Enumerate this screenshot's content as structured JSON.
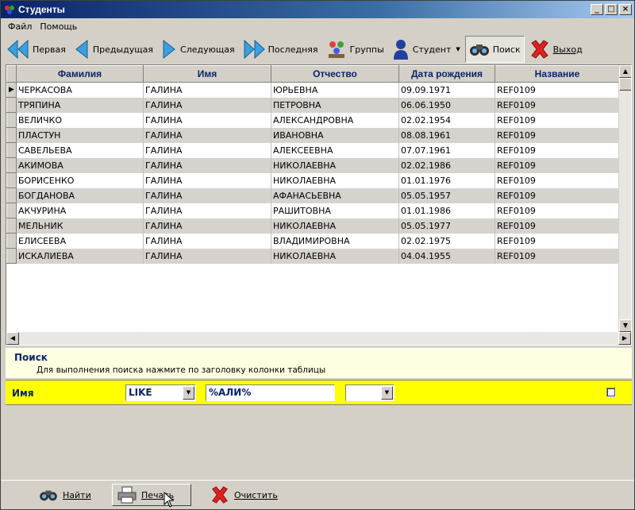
{
  "window": {
    "title": "Студенты"
  },
  "menu": [
    "Файл",
    "Помощь"
  ],
  "toolbar": {
    "first": "Первая",
    "prev": "Предыдущая",
    "next": "Следующая",
    "last": "Последняя",
    "groups": "Группы",
    "student": "Студент",
    "search": "Поиск",
    "exit": "Выход"
  },
  "grid": {
    "columns": [
      "Фамилия",
      "Имя",
      "Отчество",
      "Дата рождения",
      "Название"
    ],
    "rows": [
      [
        "ЧЕРКАСОВА",
        "ГАЛИНА",
        "ЮРЬЕВНА",
        "09.09.1971",
        "REF0109"
      ],
      [
        "ТРЯПИНА",
        "ГАЛИНА",
        "ПЕТРОВНА",
        "06.06.1950",
        "REF0109"
      ],
      [
        "ВЕЛИЧКО",
        "ГАЛИНА",
        "АЛЕКСАНДРОВНА",
        "02.02.1954",
        "REF0109"
      ],
      [
        "ПЛАСТУН",
        "ГАЛИНА",
        "ИВАНОВНА",
        "08.08.1961",
        "REF0109"
      ],
      [
        "САВЕЛЬЕВА",
        "ГАЛИНА",
        "АЛЕКСЕЕВНА",
        "07.07.1961",
        "REF0109"
      ],
      [
        "АКИМОВА",
        "ГАЛИНА",
        "НИКОЛАЕВНА",
        "02.02.1986",
        "REF0109"
      ],
      [
        "БОРИСЕНКО",
        "ГАЛИНА",
        "НИКОЛАЕВНА",
        "01.01.1976",
        "REF0109"
      ],
      [
        "БОГДАНОВА",
        "ГАЛИНА",
        "АФАНАСЬЕВНА",
        "05.05.1957",
        "REF0109"
      ],
      [
        "АКЧУРИНА",
        "ГАЛИНА",
        "РАШИТОВНА",
        "01.01.1986",
        "REF0109"
      ],
      [
        "МЕЛЬНИК",
        "ГАЛИНА",
        "НИКОЛАЕВНА",
        "05.05.1977",
        "REF0109"
      ],
      [
        "ЕЛИСЕЕВА",
        "ГАЛИНА",
        "ВЛАДИМИРОВНА",
        "02.02.1975",
        "REF0109"
      ],
      [
        "ИСКАЛИЕВА",
        "ГАЛИНА",
        "НИКОЛАЕВНА",
        "04.04.1955",
        "REF0109"
      ]
    ]
  },
  "search": {
    "heading": "Поиск",
    "hint": "Для выполнения поиска нажмите по заголовку колонки таблицы",
    "field_label": "Имя",
    "operator": "LIKE",
    "value": "%АЛИ%",
    "extra_select": ""
  },
  "bottom": {
    "find": "Найти",
    "print": "Печать",
    "clear": "Очистить"
  },
  "colors": {
    "header_text": "#0a246a",
    "criteria_bg": "#ffff00",
    "panel_bg": "#ffffe1"
  }
}
